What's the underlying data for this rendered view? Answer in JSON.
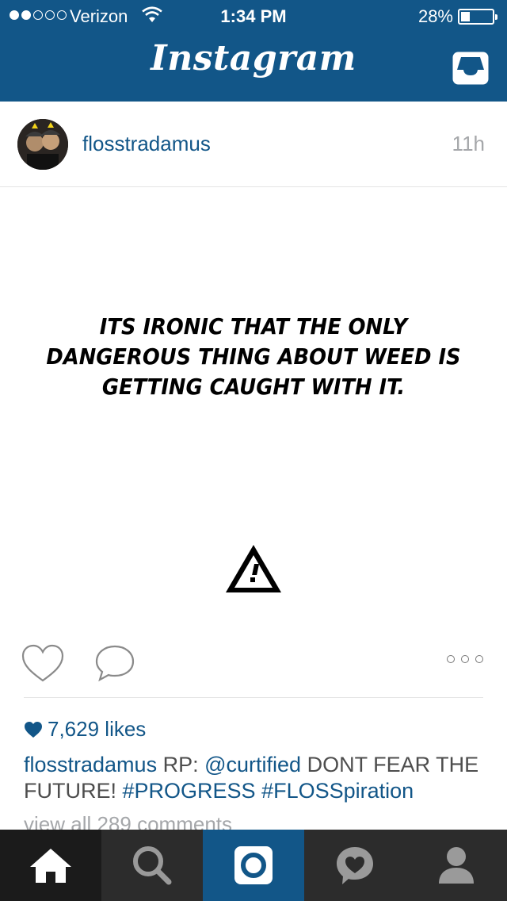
{
  "status_bar": {
    "carrier": "Verizon",
    "time": "1:34 PM",
    "battery": "28%",
    "battery_level": 0.28,
    "signal_bars_filled": 2,
    "signal_bars_total": 5
  },
  "header": {
    "logo": "Instagram",
    "inbox_icon": "inbox-icon"
  },
  "post": {
    "username": "flosstradamus",
    "age": "11h",
    "image_text": "ITS IRONIC THAT THE ONLY DANGEROUS THING ABOUT WEED IS GETTING CAUGHT WITH IT.",
    "image_icon": "warning-sign-icon",
    "likes": "7,629 likes",
    "caption": {
      "username": "flosstradamus",
      "prefix": "RP:",
      "mention": "@curtified",
      "text": "DONT FEAR THE FUTURE!",
      "hashtag1": "#PROGRESS",
      "hashtag2": "#FLOSSpiration"
    },
    "view_all": "view all 289 comments"
  },
  "tabs": [
    {
      "name": "home",
      "icon": "home-icon",
      "active": true
    },
    {
      "name": "explore",
      "icon": "search-icon"
    },
    {
      "name": "camera",
      "icon": "camera-icon"
    },
    {
      "name": "activity",
      "icon": "heart-bubble-icon"
    },
    {
      "name": "profile",
      "icon": "profile-icon"
    }
  ],
  "colors": {
    "brand": "#125688",
    "tabbar": "#2c2c2c",
    "muted": "#a5a7aa"
  }
}
